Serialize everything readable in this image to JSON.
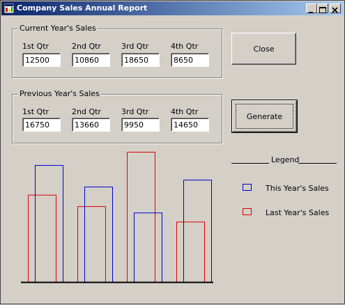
{
  "window": {
    "title": "Company Sales Annual Report"
  },
  "current_year": {
    "group_label": "Current Year's Sales",
    "quarters": [
      {
        "label": "1st Qtr",
        "value": "12500"
      },
      {
        "label": "2nd Qtr",
        "value": "10860"
      },
      {
        "label": "3rd Qtr",
        "value": "18650"
      },
      {
        "label": "4th Qtr",
        "value": "8650"
      }
    ]
  },
  "previous_year": {
    "group_label": "Previous Year's Sales",
    "quarters": [
      {
        "label": "1st Qtr",
        "value": "16750"
      },
      {
        "label": "2nd Qtr",
        "value": "13660"
      },
      {
        "label": "3rd Qtr",
        "value": "9950"
      },
      {
        "label": "4th Qtr",
        "value": "14650"
      }
    ]
  },
  "buttons": {
    "close": "Close",
    "generate": "Generate"
  },
  "legend": {
    "title": "Legend",
    "this_year": "This Year's Sales",
    "last_year": "Last Year's Sales",
    "this_year_color": "#0000cc",
    "last_year_color": "#dd0000"
  },
  "chart_data": {
    "type": "bar",
    "categories": [
      "1st Qtr",
      "2nd Qtr",
      "3rd Qtr",
      "4th Qtr"
    ],
    "series": [
      {
        "name": "This Year's Sales",
        "values": [
          16750,
          13660,
          9950,
          14650
        ],
        "color": "#0000cc"
      },
      {
        "name": "Last Year's Sales",
        "values": [
          12500,
          10860,
          18650,
          8650
        ],
        "color": "#dd0000"
      }
    ],
    "ylim": [
      0,
      18650
    ]
  }
}
